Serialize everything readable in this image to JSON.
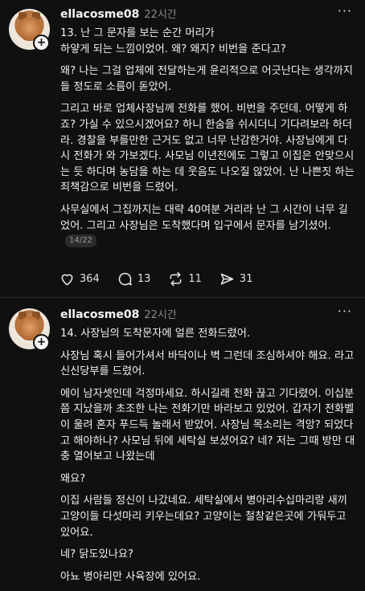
{
  "posts": [
    {
      "username": "ellacosme08",
      "time": "22시간",
      "more": "···",
      "paragraphs": [
        "13. 난 그 문자를 보는 순간 머리가\n하얗게 되는 느낌이었어. 왜? 왜지? 비번을 준다고?",
        "왜? 나는 그걸 업체에 전달하는게 윤리적으로 어긋난다는 생각까지 들 정도로 소름이 돋았어.",
        "그리고 바로 업체사장님께 전화를 했어. 비번을 주던데. 어떻게 하죠? 가실 수 있으시겠어요? 하니 한숨을 쉬시더니 기다려보라 하더라. 경찰을 부를만한 근거도 없고 너무 난감한거야. 사장님에게 다시 전화가 와 가보겠다. 사모님 이년전에도 그렇고 이집은 안맞으시는 듯 하다며 농담을 하는 데 웃음도 나오질 않았어. 난 나쁜짓 하는 죄책감으로 비번을 드렸어.",
        "사무실에서 그집까지는 대략 40여분 거리라 난 그 시간이 너무 길었어. 그리고 사장님은 도착했다며 입구에서 문자를 남기셨어."
      ],
      "badge": "14/22",
      "likes": "364",
      "comments": "13",
      "reposts": "11",
      "shares": "31"
    },
    {
      "username": "ellacosme08",
      "time": "22시간",
      "more": "···",
      "paragraphs": [
        "14. 사장님의 도착문자에 얼른 전화드렸어.",
        "사장님 혹시 들어가셔서 바닥이나 벽 그런데 조심하셔야 해요. 라고 신신당부를 드렸어.",
        "에이 남자셋인데 걱정마세요. 하시길래 전화 끊고 기다렸어. 이십분쯤 지났을까 초조한 나는 전화기만 바라보고 있었어. 갑자기 전화벨이 울려 혼자 푸드득 놀래서 받았어. 사장님 목소리는 격앙? 되었다고 해야하나? 사모님 뒤에 세탁실 보셨어요? 네? 저는 그때 방만 대충 열어보고 나왔는데",
        "왜요?",
        "이집 사람들 정신이 나갔네요. 세탁실에서 병아리수십마리랑 새끼 고양이들 다섯마리 키우는데요? 고양이는 철창같은곳에 가둬두고 있어요.",
        "네? 닭도있나요?",
        "아뇨 병아리만 사육장에 있어요."
      ]
    }
  ]
}
